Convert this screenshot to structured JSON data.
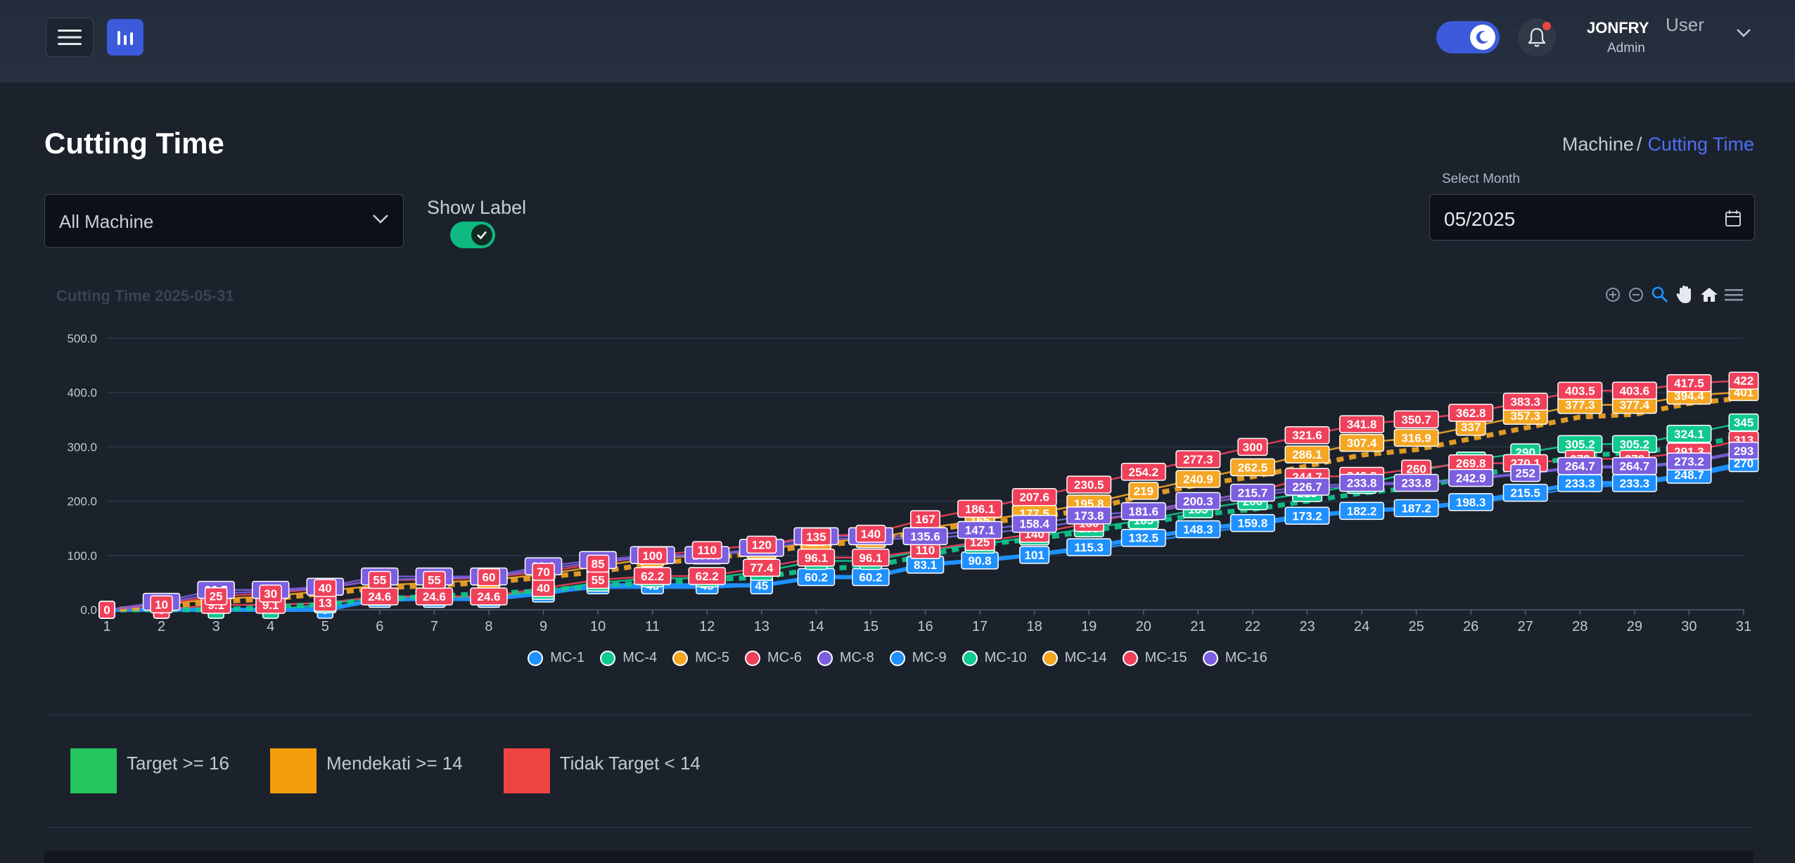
{
  "header": {
    "user_name": "JONFRY",
    "user_role": "Admin",
    "user_menu_label": "User"
  },
  "page": {
    "title": "Cutting Time",
    "breadcrumb": {
      "parent": "Machine",
      "separator": "/",
      "current": "Cutting Time"
    }
  },
  "filters": {
    "machine_select_value": "All Machine",
    "show_label_text": "Show Label",
    "show_label_on": true,
    "month_label": "Select Month",
    "month_value": "05/2025"
  },
  "chart_data": {
    "type": "line",
    "title": "Cutting Time 2025-05-31",
    "xlabel": "",
    "ylabel": "",
    "ylim": [
      0,
      500
    ],
    "grid": true,
    "legend_position": "bottom",
    "y_ticks": [
      "0.0",
      "100.0",
      "200.0",
      "300.0",
      "400.0",
      "500.0"
    ],
    "x": [
      1,
      2,
      3,
      4,
      5,
      6,
      7,
      8,
      9,
      10,
      11,
      12,
      13,
      14,
      15,
      16,
      17,
      18,
      19,
      20,
      21,
      22,
      23,
      24,
      25,
      26,
      27,
      28,
      29,
      30,
      31
    ],
    "series": [
      {
        "name": "MC-1",
        "color": "#1e90ff",
        "values": [
          0,
          0,
          0,
          0,
          0,
          20,
          20,
          20,
          30,
          45,
          45,
          45,
          45,
          60.2,
          60.2,
          83.1,
          90.8,
          101,
          115.3,
          132.5,
          148.3,
          159.8,
          173.2,
          182.2,
          187.2,
          198.3,
          215.5,
          233.3,
          233.3,
          248.7,
          270
        ]
      },
      {
        "name": "MC-4",
        "color": "#10c98f",
        "values": [
          0,
          0,
          0,
          0,
          10,
          24,
          24,
          24,
          35,
          50,
          58,
          58,
          70,
          90,
          90,
          110,
          120,
          135,
          150,
          165,
          185,
          200,
          215,
          230,
          255,
          275,
          290,
          305.2,
          305.2,
          324.1,
          345
        ]
      },
      {
        "name": "MC-5",
        "color": "#f5a623",
        "values": [
          0,
          10,
          20,
          25,
          35,
          45,
          50,
          55,
          65,
          80,
          95,
          100,
          110,
          125,
          130,
          150,
          165,
          177.5,
          195.8,
          219,
          240.9,
          262.5,
          286.1,
          307.4,
          316.9,
          337,
          357.3,
          377.3,
          377.4,
          394.4,
          401
        ]
      },
      {
        "name": "MC-6",
        "color": "#f0405a",
        "values": [
          0,
          0,
          9.1,
          9.1,
          13,
          24.6,
          24.6,
          24.6,
          40,
          55,
          62.2,
          62.2,
          77.4,
          96.1,
          96.1,
          110,
          125,
          140,
          160,
          180,
          200,
          215,
          244.7,
          246.8,
          260,
          269.8,
          270.1,
          278,
          278,
          291.3,
          313
        ]
      },
      {
        "name": "MC-8",
        "color": "#7b5fe0",
        "values": [
          0,
          14.8,
          36.7,
          36.7,
          42.5,
          61.4,
          61.4,
          61.4,
          80.1,
          91.7,
          100.7,
          100.7,
          114.1,
          135.6,
          135.6,
          135.6,
          147.1,
          158.4,
          173.8,
          181.6,
          200.3,
          215.7,
          226.7,
          233.8,
          233.8,
          242.9,
          252,
          264.7,
          264.7,
          273.2,
          293
        ]
      },
      {
        "name": "MC-9",
        "color": "#1e90ff",
        "values": [
          0,
          0,
          0,
          0,
          5,
          15,
          20,
          20,
          30,
          40,
          40,
          40,
          45,
          60,
          60,
          80,
          90,
          100,
          110,
          125,
          140,
          155,
          170,
          180,
          185,
          195,
          210,
          225,
          230,
          245,
          265
        ]
      },
      {
        "name": "MC-10",
        "color": "#10c98f",
        "values": [
          0,
          0,
          0,
          5,
          10,
          20,
          25,
          30,
          35,
          45,
          50,
          55,
          60,
          75,
          80,
          100,
          120,
          130,
          145,
          160,
          175,
          185,
          200,
          215,
          225,
          245,
          265,
          283,
          290,
          300,
          320
        ]
      },
      {
        "name": "MC-14",
        "color": "#f5a623",
        "values": [
          0,
          5,
          15,
          20,
          30,
          40,
          45,
          50,
          60,
          70,
          85,
          95,
          105,
          120,
          125,
          145,
          160,
          170,
          185,
          210,
          230,
          245,
          265,
          285,
          295,
          315,
          335,
          355,
          360,
          380,
          390
        ]
      },
      {
        "name": "MC-15",
        "color": "#f0405a",
        "values": [
          0,
          10,
          25,
          30,
          40,
          55,
          55,
          60,
          70,
          85,
          100,
          110,
          120,
          135,
          140,
          167,
          186.1,
          207.6,
          230.5,
          254.2,
          277.3,
          300,
          321.6,
          341.8,
          350.7,
          362.8,
          383.3,
          403.5,
          403.6,
          417.5,
          422
        ]
      },
      {
        "name": "MC-16",
        "color": "#7b5fe0",
        "values": [
          0,
          12,
          30,
          34,
          40,
          55,
          58,
          60,
          75,
          88,
          98,
          100,
          110,
          130,
          132,
          130,
          140,
          150,
          165,
          178,
          195,
          210,
          222,
          230,
          232,
          240,
          250,
          262,
          262,
          270,
          290
        ]
      }
    ],
    "labeled_series": [
      "MC-1",
      "MC-4",
      "MC-5",
      "MC-6",
      "MC-8",
      "MC-15"
    ]
  },
  "status_legend": [
    {
      "label": "Target >= 16",
      "color": "#22c55e"
    },
    {
      "label": "Mendekati >= 14",
      "color": "#f59e0b"
    },
    {
      "label": "Tidak Target < 14",
      "color": "#ef4444"
    }
  ],
  "icons": {
    "menu": "hamburger-icon",
    "logo": "bar-chart-icon",
    "theme": "moon-icon",
    "bell": "bell-icon",
    "calendar": "calendar-icon",
    "zoom_in": "zoom-in-icon",
    "zoom_out": "zoom-out-icon",
    "selection_zoom": "magnifier-icon",
    "pan": "hand-icon",
    "reset": "home-icon",
    "chart_menu": "hamburger-icon"
  }
}
